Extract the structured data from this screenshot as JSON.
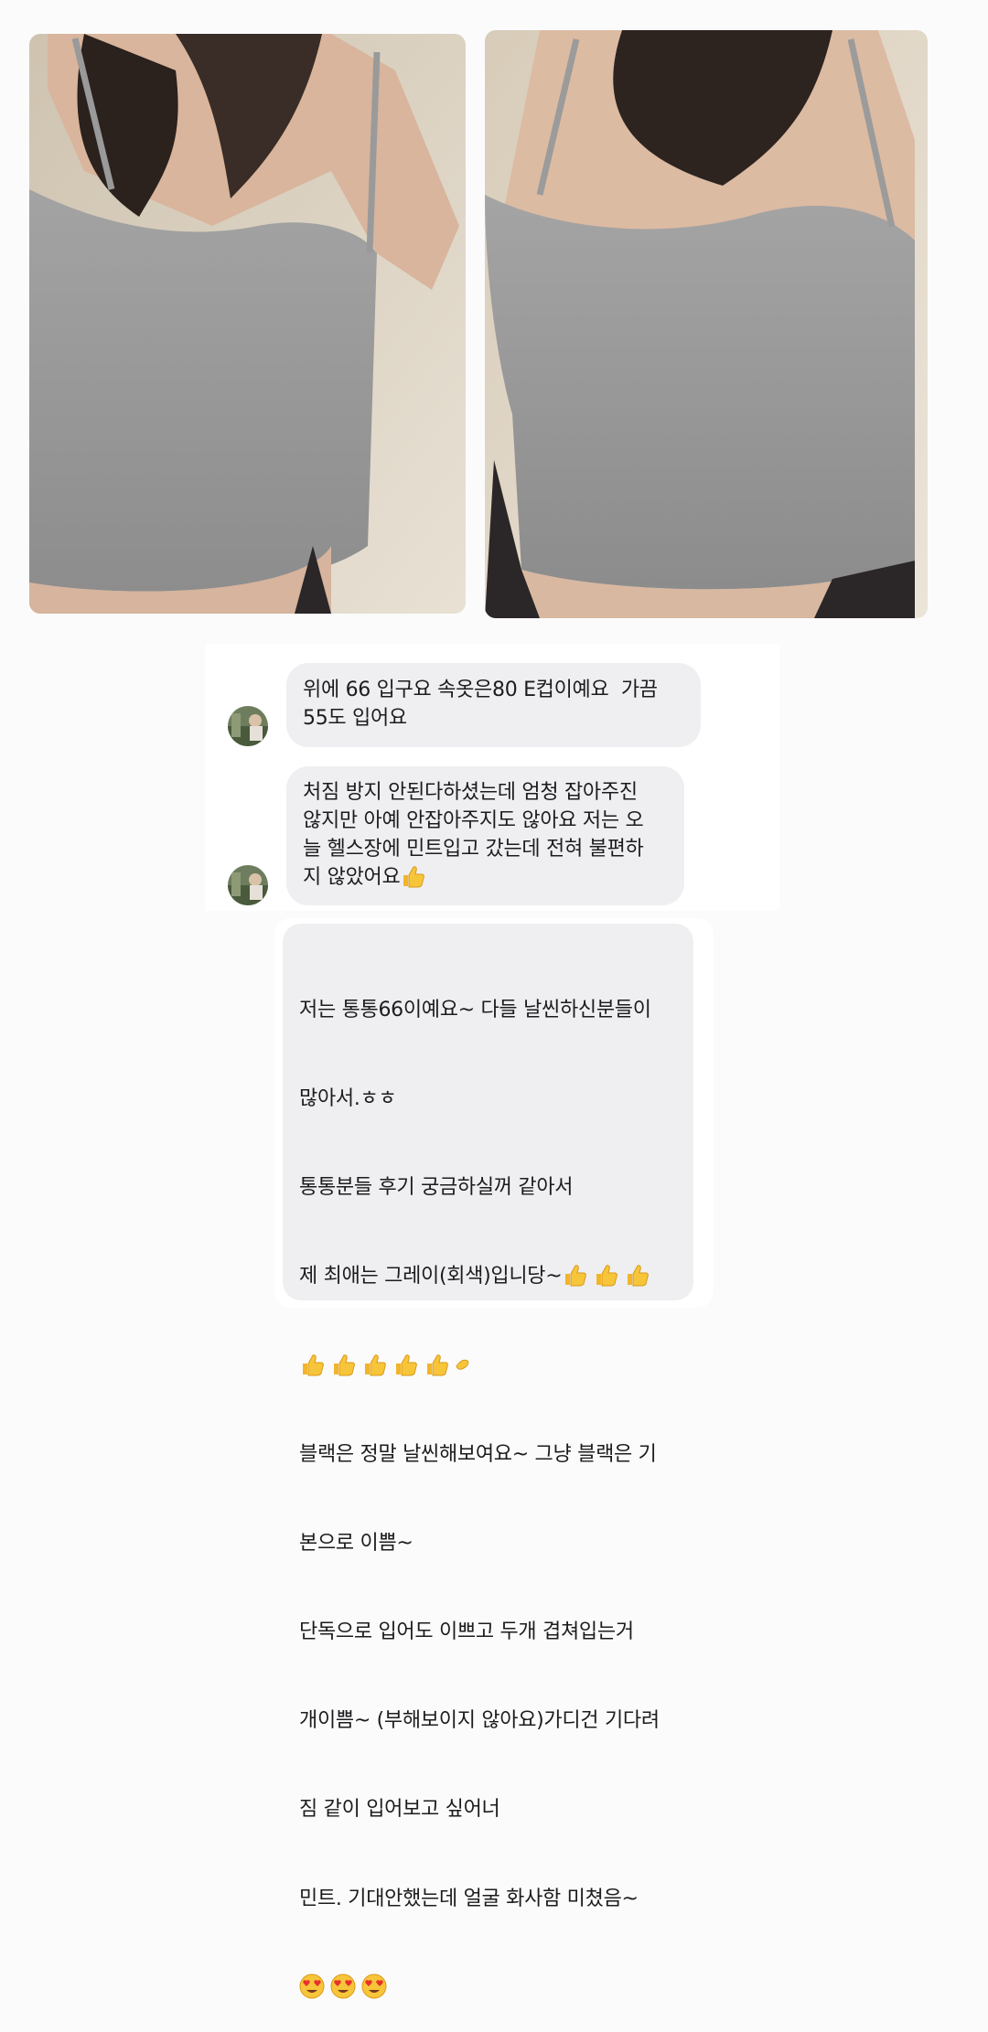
{
  "photos": [
    {
      "name": "left",
      "alt": "gray tank top photo 1"
    },
    {
      "name": "right",
      "alt": "gray tank top photo 2"
    }
  ],
  "messages": [
    {
      "id": "bubble-1",
      "text": "위에 66 입구요 속옷은80 E컵이예요  가끔\n55도 입어요"
    },
    {
      "id": "bubble-2",
      "text": "처짐 방지 안된다하셨는데 엄청 잡아주진\n않지만 아예 안잡아주지도 않아요 저는 오\n늘 헬스장에 민트입고 갔는데 전혀 불편하\n지 않았어요"
    },
    {
      "id": "bubble-3",
      "lines": [
        "저는 통통66이예요~ 다들 날씬하신분들이",
        "많아서.ㅎㅎ",
        "통통분들 후기 궁금하실꺼 같아서",
        "제 최애는 그레이(회색)입니당~",
        "블랙은 정말 날씬해보여요~ 그냥 블랙은 기",
        "본으로 이쁨~",
        "단독으로 입어도 이쁘고 두개 겹쳐입는거",
        "개이쁨~ (부해보이지 않아요)가디건 기다려",
        "짐 같이 입어보고 싶어너",
        "민트. 기대안했는데 얼굴 화사함 미쳤음~"
      ]
    }
  ],
  "emoji": {
    "thumbs_up": "thumbs-up",
    "heart_eyes": "heart-eyes"
  },
  "colors": {
    "bubble_bg": "#efeff2",
    "page_bg": "#fbfbfc",
    "emoji_yellow": "#f7c53a"
  }
}
